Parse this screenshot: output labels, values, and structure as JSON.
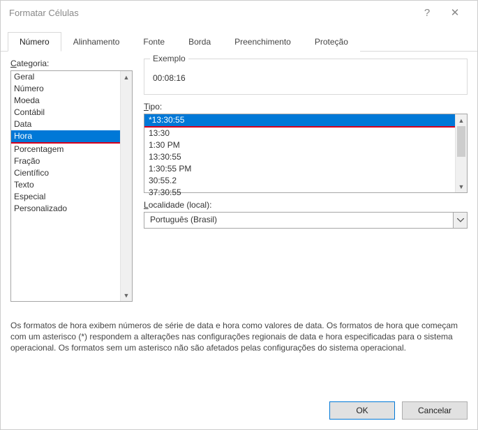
{
  "window": {
    "title": "Formatar Células"
  },
  "tabs": [
    {
      "label": "Número"
    },
    {
      "label": "Alinhamento"
    },
    {
      "label": "Fonte"
    },
    {
      "label": "Borda"
    },
    {
      "label": "Preenchimento"
    },
    {
      "label": "Proteção"
    }
  ],
  "category": {
    "label_pre": "C",
    "label_rest": "ategoria:",
    "items": [
      "Geral",
      "Número",
      "Moeda",
      "Contábil",
      "Data",
      "Hora",
      "Porcentagem",
      "Fração",
      "Científico",
      "Texto",
      "Especial",
      "Personalizado"
    ],
    "selected_index": 5
  },
  "example": {
    "label": "Exemplo",
    "value": "00:08:16"
  },
  "type": {
    "label_pre": "T",
    "label_rest": "ipo:",
    "items": [
      "*13:30:55",
      "13:30",
      "1:30 PM",
      "13:30:55",
      "1:30:55 PM",
      "30:55.2",
      "37:30:55"
    ],
    "selected_index": 0
  },
  "locale": {
    "label_pre": "L",
    "label_rest": "ocalidade (local):",
    "value": "Português (Brasil)"
  },
  "description": "Os formatos de hora exibem números de série de data e hora como valores de data. Os formatos de hora que começam com um asterisco (*) respondem a alterações nas configurações regionais de data e hora especificadas para o sistema operacional. Os formatos sem um asterisco não são afetados pelas configurações do sistema operacional.",
  "buttons": {
    "ok": "OK",
    "cancel": "Cancelar"
  }
}
